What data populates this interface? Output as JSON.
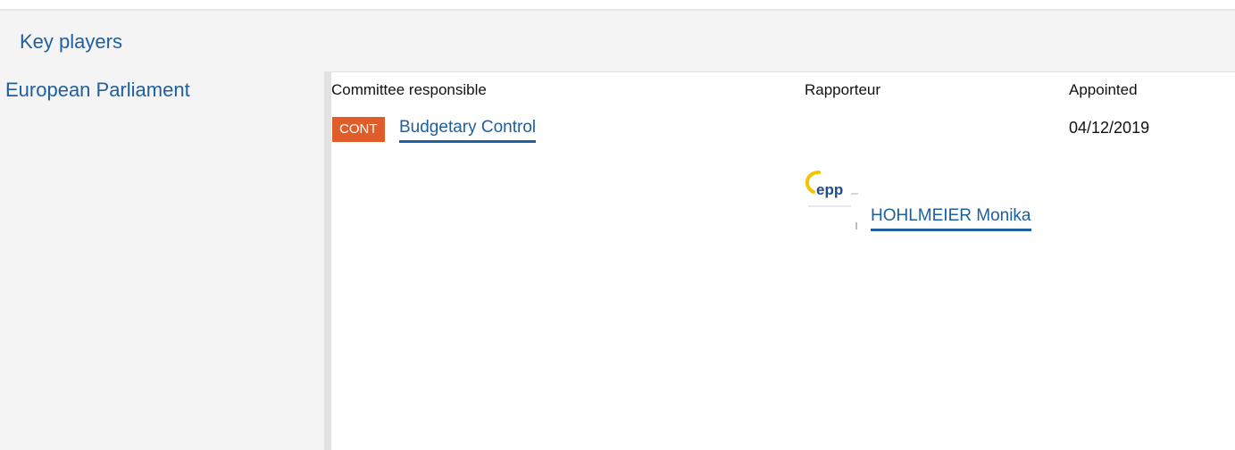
{
  "section": {
    "title": "Key players"
  },
  "institution": {
    "name": "European Parliament"
  },
  "columns": {
    "committee": "Committee responsible",
    "rapporteur": "Rapporteur",
    "appointed": "Appointed"
  },
  "committee": {
    "code": "CONT",
    "name": "Budgetary Control",
    "badge_color": "#e05c28"
  },
  "rapporteur": {
    "name": "HOHLMEIER Monika",
    "group_logo_icon": "epp-group-logo"
  },
  "appointed": {
    "date": "04/12/2019"
  },
  "colors": {
    "link": "#1e5fa0",
    "panel": "#f4f4f4"
  }
}
